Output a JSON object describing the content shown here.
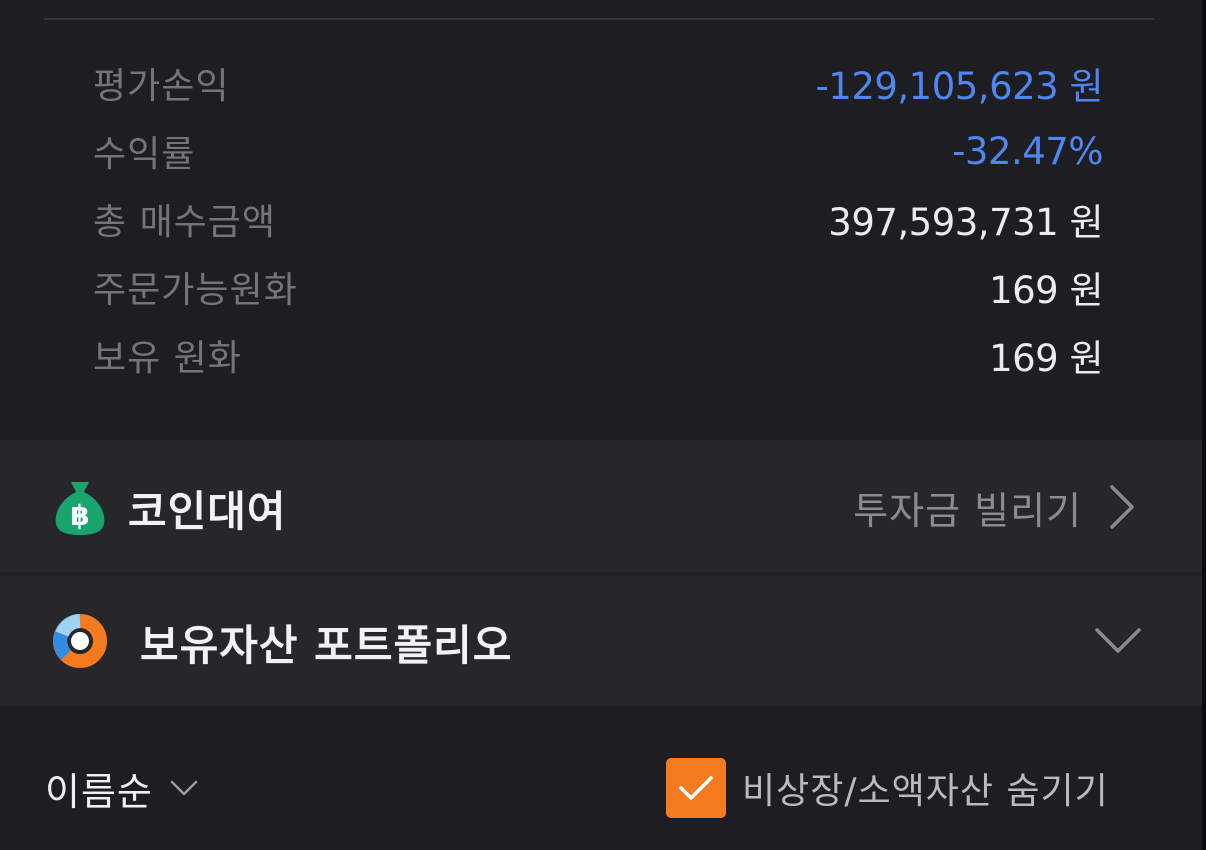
{
  "summary": {
    "rows": [
      {
        "label": "평가손익",
        "value": "-129,105,623 원",
        "negative": true
      },
      {
        "label": "수익률",
        "value": "-32.47%",
        "negative": true
      },
      {
        "label": "총 매수금액",
        "value": "397,593,731 원",
        "negative": false
      },
      {
        "label": "주문가능원화",
        "value": "169 원",
        "negative": false
      },
      {
        "label": "보유 원화",
        "value": "169 원",
        "negative": false
      }
    ]
  },
  "lending": {
    "title": "코인대여",
    "link_label": "투자금 빌리기",
    "icon": "money-bag-bitcoin-icon"
  },
  "portfolio": {
    "title": "보유자산 포트폴리오",
    "icon": "donut-chart-icon",
    "expand_icon": "chevron-down-icon"
  },
  "controls": {
    "sort_label": "이름순",
    "hide_label": "비상장/소액자산 숨기기",
    "hide_checked": true
  },
  "colors": {
    "negative": "#4f86f0",
    "accent": "#f47a20",
    "lend_icon": "#1aa56e",
    "donut_blue": "#2f8de4",
    "donut_orange": "#f47a20"
  }
}
